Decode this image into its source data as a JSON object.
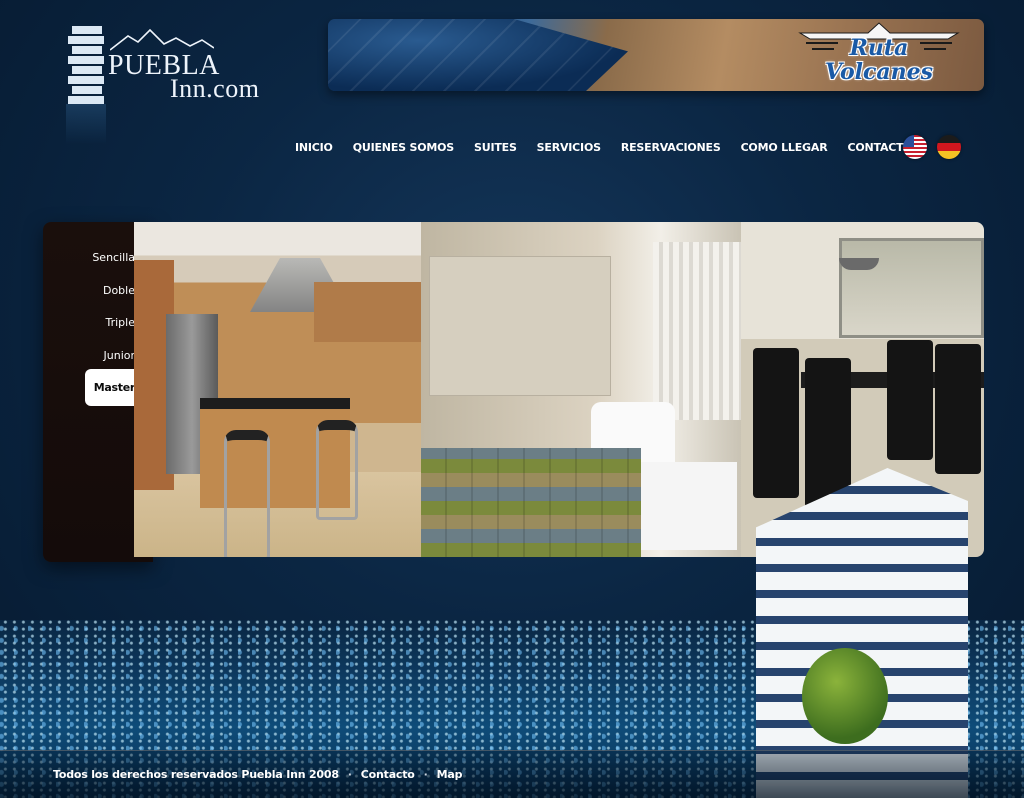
{
  "header": {
    "logo": {
      "line1": "PUEBLA",
      "line2": "Inn.com"
    },
    "banner": {
      "partner_logo": {
        "line1": "Ruta",
        "line2": "Volcanes"
      }
    }
  },
  "nav": {
    "items": [
      {
        "label": "INICIO"
      },
      {
        "label": "QUIENES SOMOS"
      },
      {
        "label": "SUITES"
      },
      {
        "label": "SERVICIOS"
      },
      {
        "label": "RESERVACIONES"
      },
      {
        "label": "COMO LLEGAR"
      },
      {
        "label": "CONTACTO"
      }
    ],
    "flags": [
      {
        "icon": "us-flag-icon"
      },
      {
        "icon": "germany-flag-icon"
      }
    ]
  },
  "suites": {
    "tabs": [
      {
        "label": "Sencilla",
        "active": false
      },
      {
        "label": "Doble",
        "active": false
      },
      {
        "label": "Triple",
        "active": false
      },
      {
        "label": "Junior",
        "active": false
      },
      {
        "label": "Master",
        "active": true
      }
    ],
    "photos": [
      {
        "name": "kitchen-photo"
      },
      {
        "name": "bedroom-photo"
      },
      {
        "name": "dining-room-photo"
      }
    ]
  },
  "footer": {
    "copyright": "Todos los derechos reservados Puebla Inn 2008",
    "separator": "·",
    "links": [
      {
        "label": "Contacto"
      },
      {
        "label": "Map"
      }
    ]
  },
  "colors": {
    "background": "#0b2643",
    "active_tab_bg": "#ffffff",
    "sidebar_bg": "#1a0f0c",
    "nav_text": "#ffffff"
  }
}
